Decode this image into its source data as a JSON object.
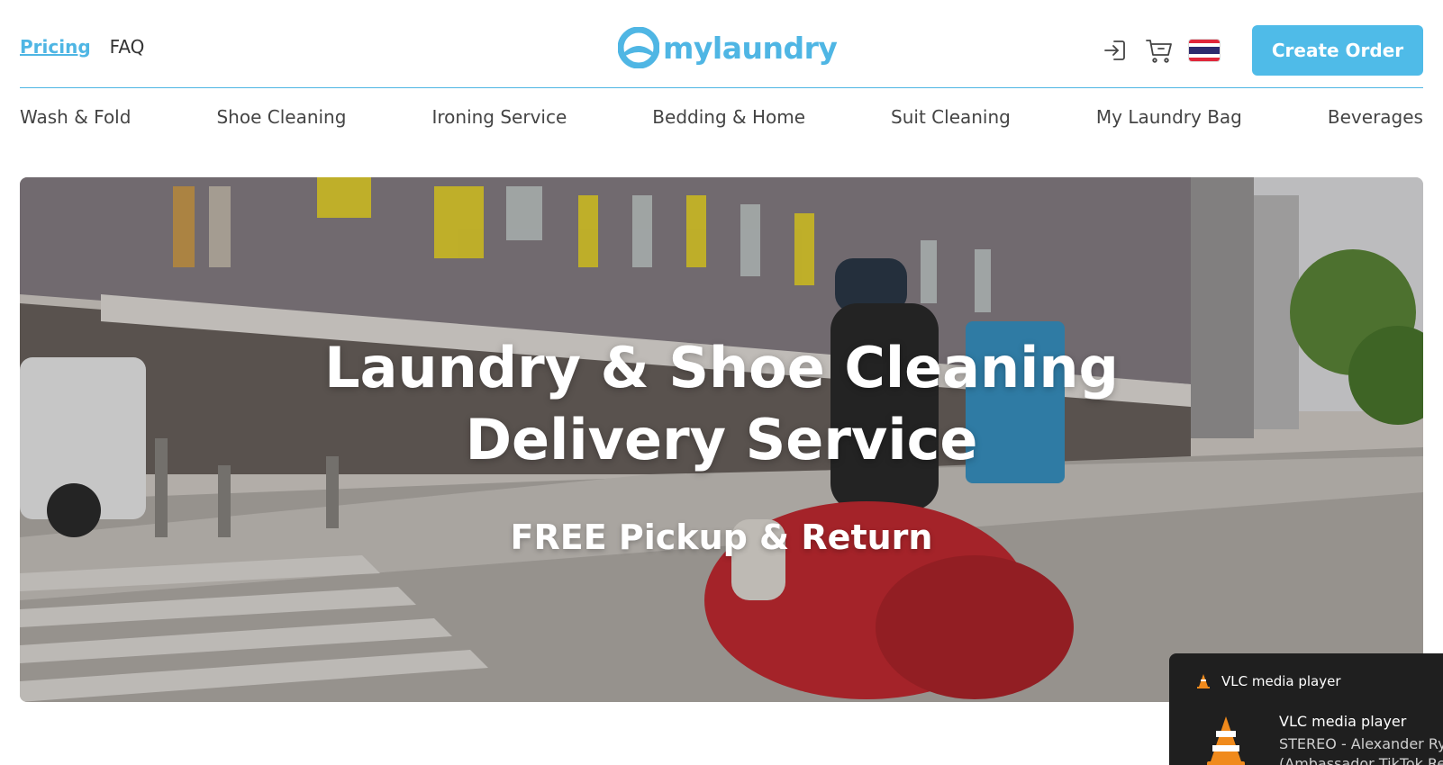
{
  "header": {
    "nav": [
      {
        "label": "Pricing",
        "active": true
      },
      {
        "label": "FAQ",
        "active": false
      }
    ],
    "logo_text": "mylaundry",
    "icons": [
      "login-icon",
      "cart-icon",
      "thai-flag-icon"
    ],
    "create_order_label": "Create Order",
    "accent_color": "#4fb6e4"
  },
  "services": [
    "Wash & Fold",
    "Shoe Cleaning",
    "Ironing Service",
    "Bedding & Home",
    "Suit Cleaning",
    "My Laundry Bag",
    "Beverages"
  ],
  "hero": {
    "title_line1": "Laundry & Shoe Cleaning",
    "title_line2": "Delivery Service",
    "subtitle": "FREE Pickup & Return"
  },
  "notification": {
    "header": "VLC media player",
    "app": "VLC media player",
    "line1": "STEREO - Alexander Ryb",
    "line2": "(Ambassador TikTok Re"
  }
}
